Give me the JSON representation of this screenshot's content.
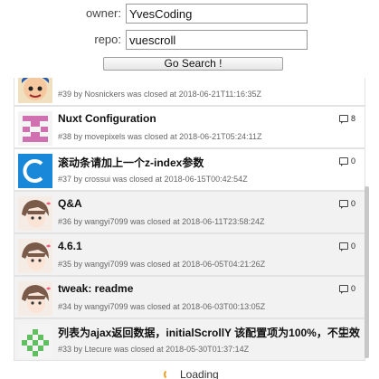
{
  "search": {
    "owner_label": "owner:",
    "owner_value": "YvesCoding",
    "repo_label": "repo:",
    "repo_value": "vuescroll",
    "button_label": "Go Search !"
  },
  "issues": [
    {
      "title": "",
      "meta": "#39 by Nosnickers was closed at 2018-06-21T11:16:35Z",
      "comments": "",
      "avatar": "cartoon-avatar"
    },
    {
      "title": "Nuxt Configuration",
      "meta": "#38 by movepixels was closed at 2018-06-21T05:24:11Z",
      "comments": "8",
      "avatar": "identicon-pink"
    },
    {
      "title": "滚动条请加上一个z-index参数",
      "meta": "#37 by crossui was closed at 2018-06-15T00:42:54Z",
      "comments": "0",
      "avatar": "letter-c-avatar"
    },
    {
      "title": "Q&A",
      "meta": "#36 by wangyi7099 was closed at 2018-06-11T23:58:24Z",
      "comments": "0",
      "avatar": "anime-avatar"
    },
    {
      "title": "4.6.1",
      "meta": "#35 by wangyi7099 was closed at 2018-06-05T04:21:26Z",
      "comments": "0",
      "avatar": "anime-avatar"
    },
    {
      "title": "tweak: readme",
      "meta": "#34 by wangyi7099 was closed at 2018-06-03T00:13:05Z",
      "comments": "0",
      "avatar": "anime-avatar"
    },
    {
      "title": "列表为ajax返回数据，initialScrollY 该配置项为100%，不生效",
      "meta": "#33 by Ltecure was closed at 2018-05-30T01:37:14Z",
      "comments": "3",
      "avatar": "identicon-green"
    }
  ],
  "loading_text": "Loading",
  "colors": {
    "pink": "#d070b0",
    "green": "#60c060",
    "blue": "#1a88d8"
  }
}
